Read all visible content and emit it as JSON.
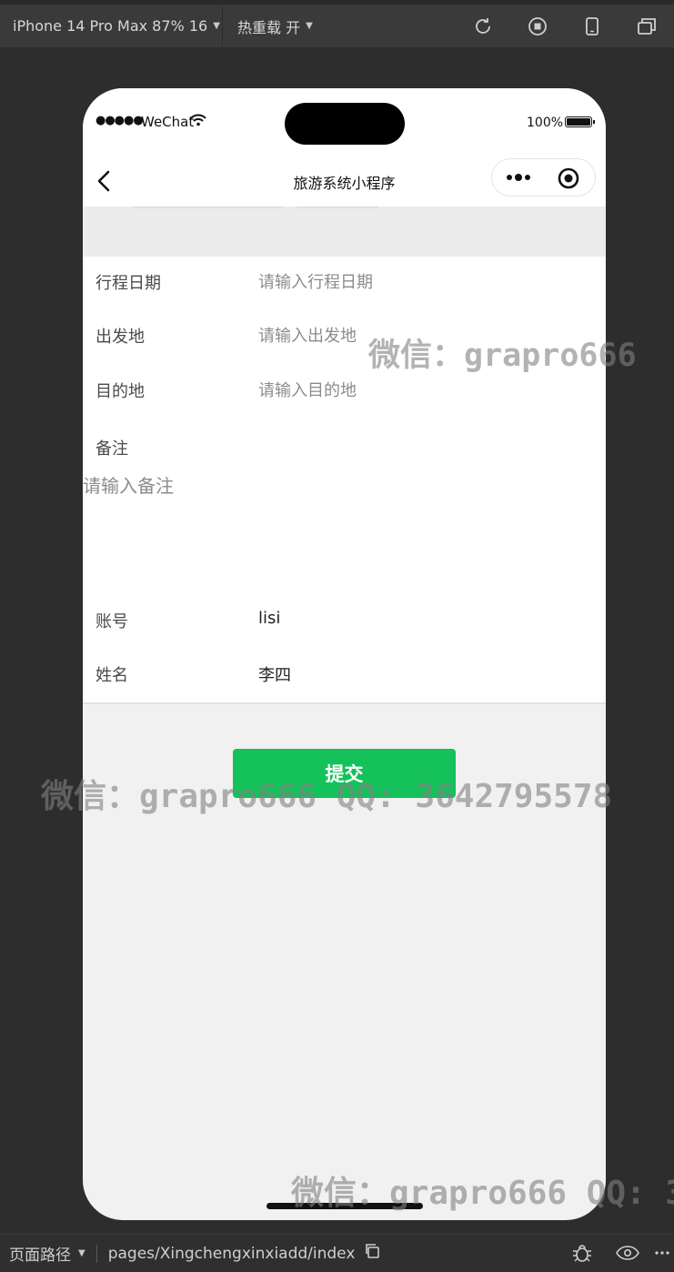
{
  "toolbar": {
    "device_label": "iPhone 14 Pro Max 87% 16",
    "hot_reload_label": "热重载 开",
    "icons": [
      "refresh-icon",
      "stop-icon",
      "phone-icon",
      "window-icon"
    ]
  },
  "status_bar": {
    "carrier": "WeChat",
    "battery": "100%"
  },
  "nav": {
    "title": "旅游系统小程序"
  },
  "form": {
    "trip_date": {
      "label": "行程日期",
      "placeholder": "请输入行程日期"
    },
    "departure": {
      "label": "出发地",
      "placeholder": "请输入出发地"
    },
    "destination": {
      "label": "目的地",
      "placeholder": "请输入目的地"
    },
    "remark": {
      "label": "备注",
      "placeholder": "请输入备注"
    },
    "account": {
      "label": "账号",
      "value": "lisi"
    },
    "name": {
      "label": "姓名",
      "value": "李四"
    }
  },
  "submit_label": "提交",
  "watermarks": {
    "wm1": "微信：grapro666",
    "wm2": "微信：grapro666 QQ: 3642795578",
    "wm3": "微信：grapro666 QQ: 3"
  },
  "bottom_bar": {
    "path_label": "页面路径",
    "path": "pages/Xingchengxinxiadd/index"
  },
  "colors": {
    "accent": "#14c15b",
    "page_background": "#f1f1f1",
    "ide_background": "#2d2d2d"
  }
}
